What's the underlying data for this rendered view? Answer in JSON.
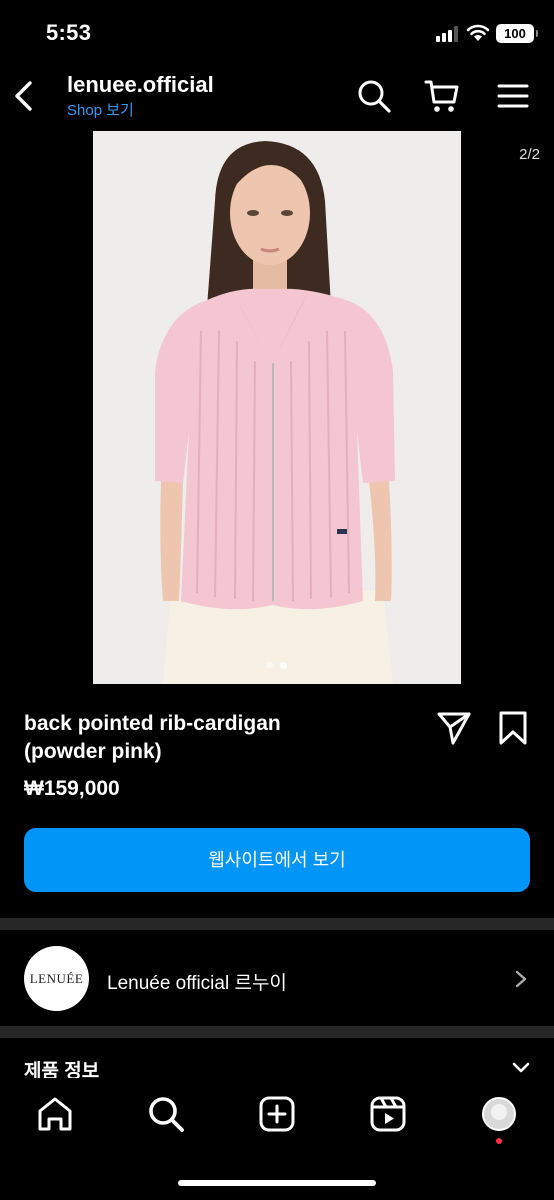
{
  "status_bar": {
    "time": "5:53",
    "battery": "100"
  },
  "header": {
    "account": "lenuee.official",
    "shop_link": "Shop 보기",
    "icons": [
      "back-chevron-icon",
      "search-icon",
      "cart-icon",
      "menu-icon"
    ]
  },
  "product": {
    "page_counter": "2/2",
    "carousel": {
      "count": 2,
      "active": 2
    },
    "title_line1": "back pointed rib-cardigan",
    "title_line2": "(powder pink)",
    "price": "₩159,000",
    "website_button": "웹사이트에서 보기",
    "actions": [
      "share-icon",
      "save-bookmark-icon"
    ]
  },
  "seller": {
    "avatar_text": "LENUÉE",
    "name": "Lenuée official 르누이"
  },
  "info_section": {
    "title": "제품 정보"
  },
  "tab_bar": {
    "tabs": [
      "home-icon",
      "search-icon",
      "create-icon",
      "reels-icon",
      "profile-avatar"
    ],
    "notification_color": "#ff3040"
  },
  "colors": {
    "accent": "#0095f6",
    "link": "#3797f0",
    "background": "#000000",
    "divider": "#262626"
  }
}
